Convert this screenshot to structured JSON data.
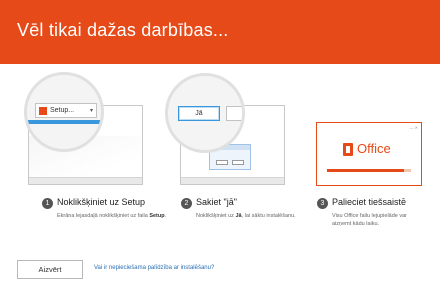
{
  "header": {
    "title": "Vēl tikai dažas darbības...",
    "color": "#e64a19"
  },
  "illustrations": {
    "step1": {
      "button_label": "Setup..."
    },
    "step2": {
      "yes_label": "Jā"
    },
    "step3": {
      "brand_text": "Office",
      "progress_fraction": 0.92
    }
  },
  "steps": [
    {
      "number": "1",
      "title": "Noklikšķiniet uz Setup",
      "desc_pre": "Ekrāna lejasdaļā noklikšķiniet uz faila ",
      "desc_bold": "Setup",
      "desc_post": "."
    },
    {
      "number": "2",
      "title": "Sakiet \"jā\"",
      "desc_pre": "Noklikšķiniet uz ",
      "desc_bold": "Jā",
      "desc_post": ", lai sāktu instalēšanu."
    },
    {
      "number": "3",
      "title": "Palieciet tiešsaistē",
      "desc_pre": "Visu Office failu lejupielāde var aizņemt kādu laiku.",
      "desc_bold": "",
      "desc_post": ""
    }
  ],
  "footer": {
    "close_label": "Aizvērt",
    "help_link": "Vai ir nepieciešama palīdzība ar instalēšanu?"
  }
}
